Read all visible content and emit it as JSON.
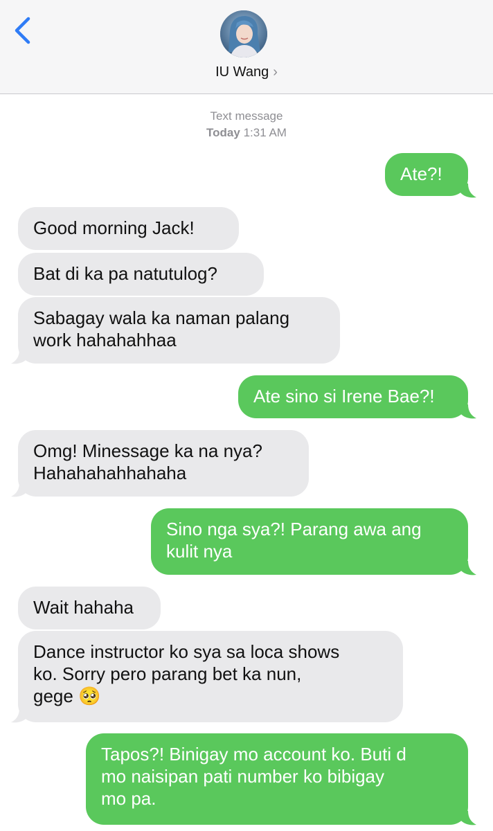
{
  "colors": {
    "header_bg": "#f6f6f7",
    "incoming_bubble": "#e9e9eb",
    "outgoing_bubble": "#5ac85c",
    "accent_blue": "#2f7cf6",
    "meta_gray": "#8e8e93"
  },
  "header": {
    "back_icon": "chevron-left-icon",
    "contact_name": "IU Wang",
    "contact_chevron": "›",
    "avatar": "contact-photo"
  },
  "meta": {
    "line1": "Text message",
    "day": "Today",
    "time": "1:31 AM"
  },
  "messages": [
    {
      "direction": "out",
      "text": "Ate?!"
    },
    {
      "direction": "in",
      "text": "Good morning Jack!"
    },
    {
      "direction": "in",
      "text": "Bat di ka pa natutulog?"
    },
    {
      "direction": "in",
      "text": "Sabagay wala ka naman palang\nwork hahahahhaa"
    },
    {
      "direction": "out",
      "text": "Ate sino si Irene Bae?!"
    },
    {
      "direction": "in",
      "text": "Omg! Minessage ka na nya?\nHahahahahhahaha"
    },
    {
      "direction": "out",
      "text": "Sino nga sya?! Parang awa ang\nkulit nya"
    },
    {
      "direction": "in",
      "text": "Wait hahaha"
    },
    {
      "direction": "in",
      "text": "Dance instructor ko sya sa loca shows\nko. Sorry pero parang bet ka nun,\ngege 🥺"
    },
    {
      "direction": "out",
      "text": "Tapos?! Binigay mo account ko. Buti d\nmo naisipan pati number ko bibigay\nmo pa."
    }
  ]
}
